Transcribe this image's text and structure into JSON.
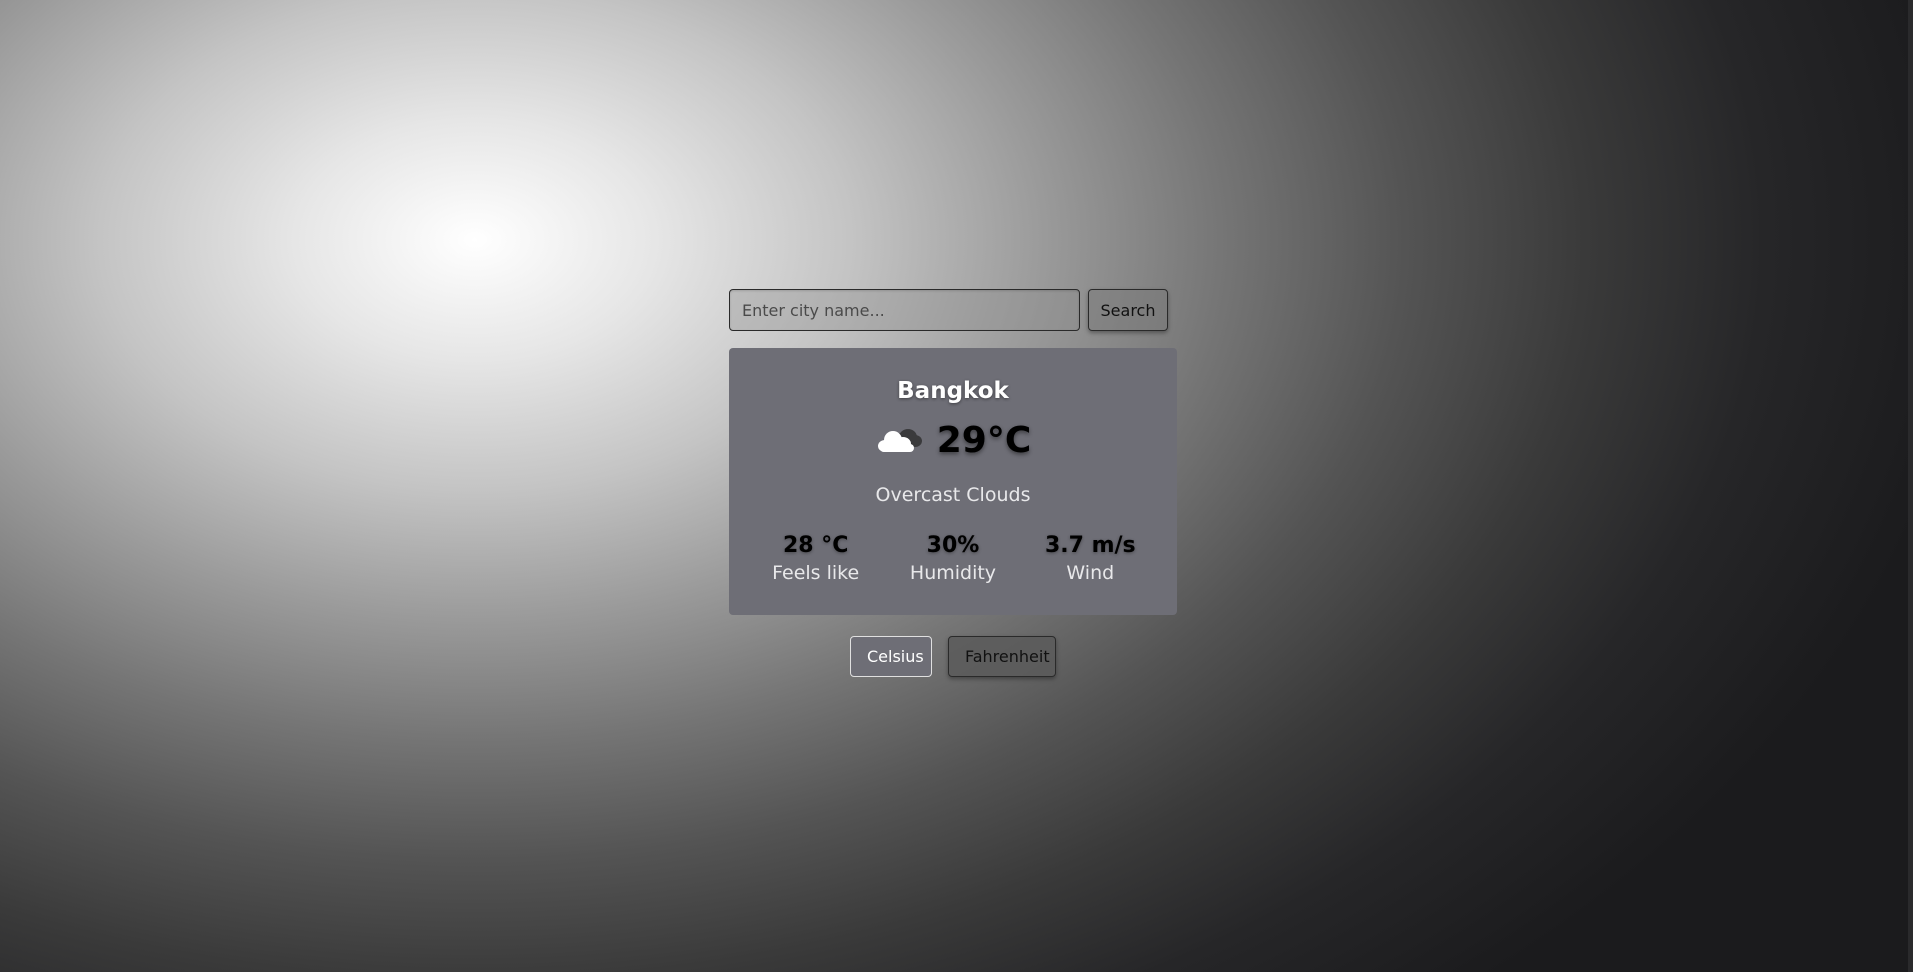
{
  "search": {
    "placeholder": "Enter city name...",
    "value": "",
    "button_label": "Search"
  },
  "weather": {
    "city": "Bangkok",
    "temperature": "29°C",
    "description": "Overcast Clouds",
    "icon": "overcast-clouds-icon",
    "stats": [
      {
        "value": "28 °C",
        "label": "Feels like"
      },
      {
        "value": "30%",
        "label": "Humidity"
      },
      {
        "value": "3.7 m/s",
        "label": "Wind"
      }
    ]
  },
  "units": {
    "celsius_label": "Celsius",
    "fahrenheit_label": "Fahrenheit",
    "selected": "Celsius"
  },
  "colors": {
    "card_background": "#6e6e76",
    "text_light": "#ffffff"
  }
}
